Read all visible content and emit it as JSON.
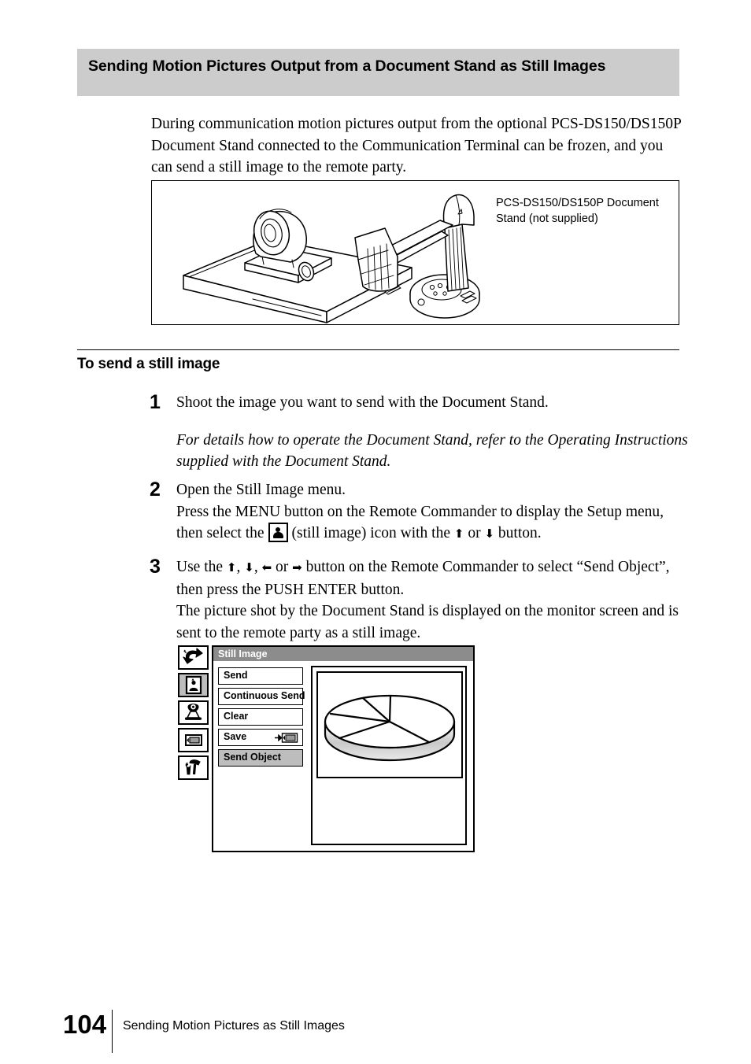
{
  "section": {
    "heading": "Sending Motion Pictures Output from a Document Stand as Still Images",
    "heading_bg": "#cccccc"
  },
  "intro": {
    "paragraph": "During communication motion pictures output from the optional PCS-DS150/DS150P Document Stand connected to the Communication Terminal can be frozen, and you can send a still image to the remote party."
  },
  "figure": {
    "caption": "PCS-DS150/DS150P Document Stand (not supplied)",
    "items": [
      {
        "name": "communication-terminal-camera"
      },
      {
        "name": "document-stand"
      }
    ]
  },
  "subsection": {
    "title": "To send a still image"
  },
  "steps": [
    {
      "number": "1",
      "lines": [
        {
          "text": "Shoot the image you want to send with the Document Stand.",
          "style": "normal"
        },
        {
          "text": "For details how to operate the Document Stand, refer to the Operating Instructions supplied with the Document Stand.",
          "style": "italic"
        }
      ]
    },
    {
      "number": "2",
      "lines": [
        {
          "text": "Open the Still Image menu.",
          "style": "normal"
        }
      ],
      "rich": {
        "part1": "Press the MENU button on the Remote Commander to display the Setup menu, then select the",
        "icon": "still-image-icon",
        "part2": "(still image) icon with the",
        "arrow_up": "⬆",
        "or": "or",
        "arrow_down": "⬇",
        "part3": "button."
      }
    },
    {
      "number": "3",
      "rich": {
        "part1": "Use the",
        "arrow_up": "⬆",
        "arrow_down": "⬇",
        "arrow_left": "⬅",
        "arrow_right": "➡",
        "part2": "button on the Remote Commander to select “Send Object”, then press the PUSH ENTER button.",
        "part3": "The picture shot by the Document Stand is displayed on the monitor screen and is sent to the remote party as a still image."
      }
    }
  ],
  "osd": {
    "title": "Still Image",
    "title_bg": "#8c8c8c",
    "highlight_bg": "#bdbdbd",
    "sidebar_icons": [
      {
        "name": "back-arrow-icon",
        "selected": false
      },
      {
        "name": "still-image-icon",
        "selected": true
      },
      {
        "name": "camera-icon",
        "selected": false
      },
      {
        "name": "memory-card-icon",
        "selected": false
      },
      {
        "name": "tools-icon",
        "selected": false
      }
    ],
    "menu_items": [
      {
        "label": "Send",
        "highlighted": false,
        "target_icon": null
      },
      {
        "label": "Continuous Send",
        "highlighted": false,
        "target_icon": null
      },
      {
        "label": "Clear",
        "highlighted": false,
        "target_icon": null
      },
      {
        "label": "Save",
        "highlighted": false,
        "target_icon": "arrow-to-memory-card-icon"
      },
      {
        "label": "Send Object",
        "highlighted": true,
        "target_icon": null
      }
    ],
    "preview": {
      "content": "3d-pie-chart",
      "slices": 5
    }
  },
  "footer": {
    "page_number": "104",
    "title": "Sending Motion Pictures as Still Images"
  }
}
